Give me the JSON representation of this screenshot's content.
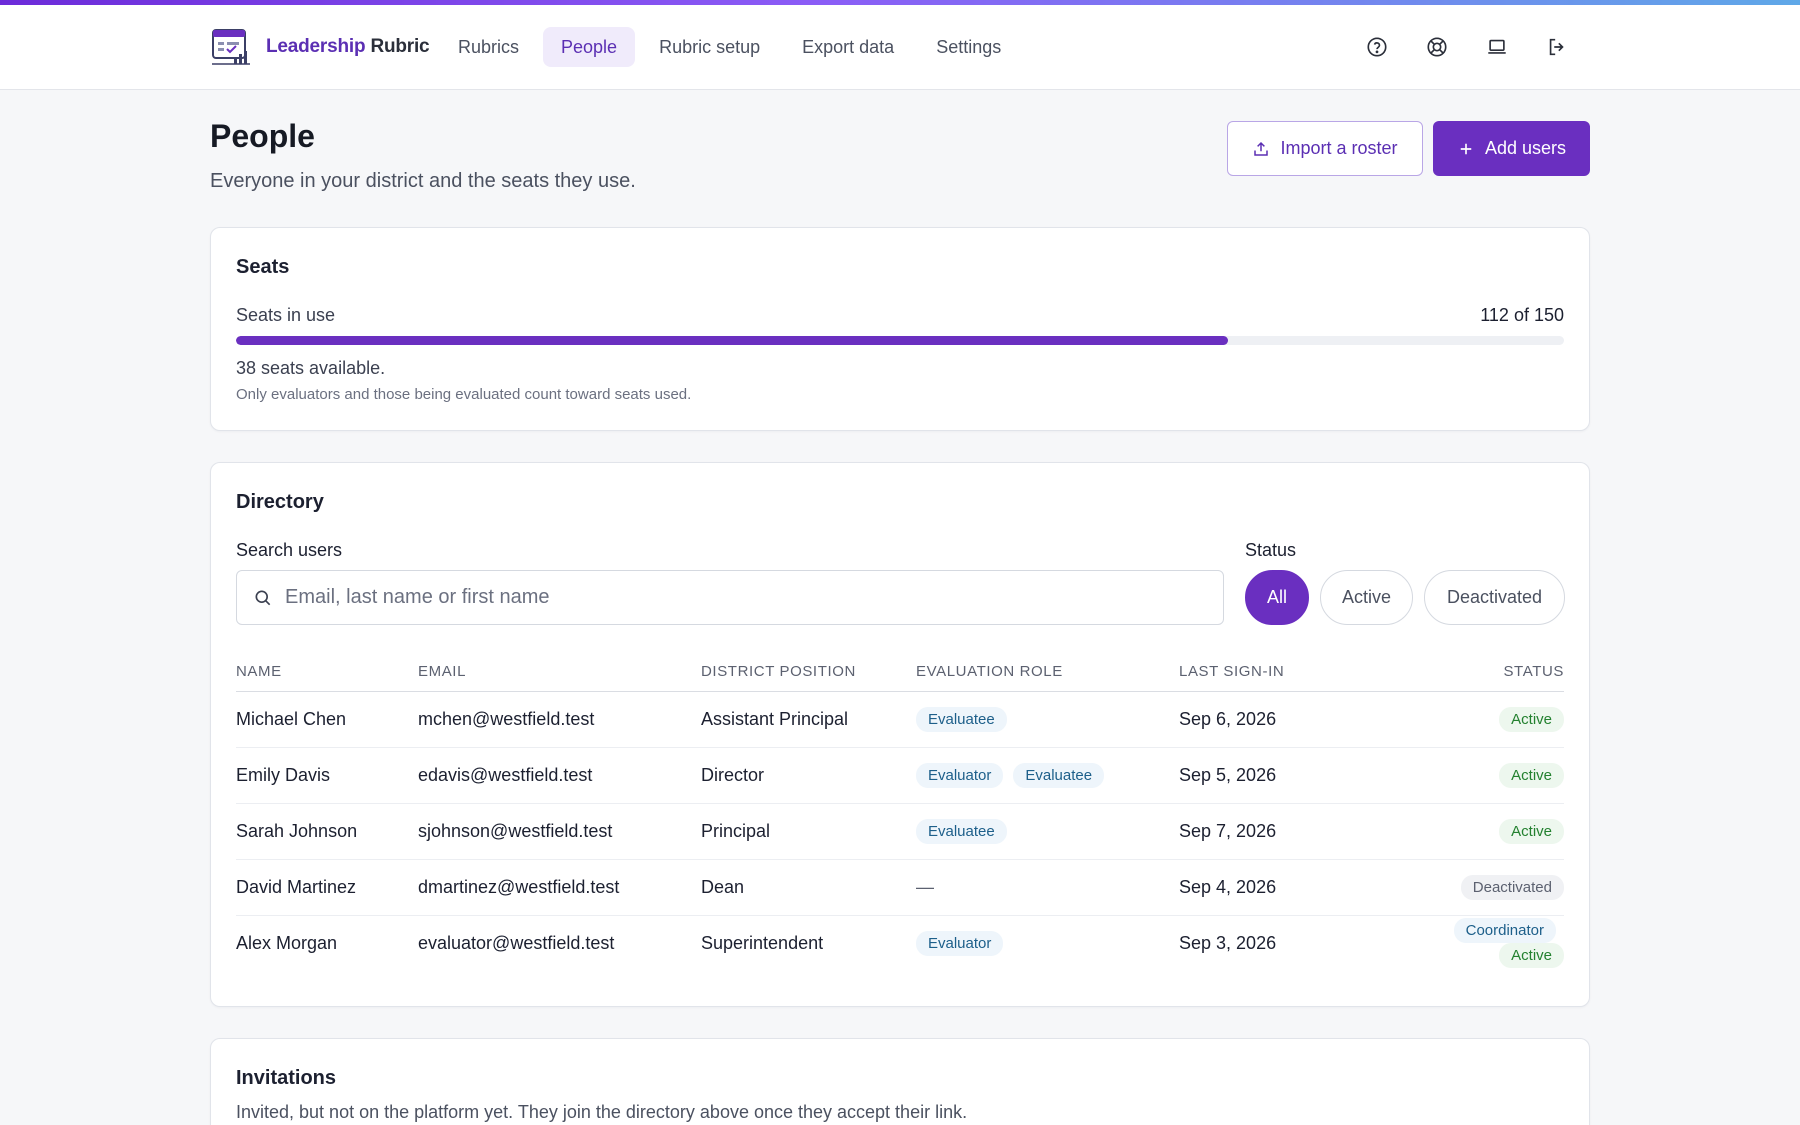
{
  "brand": {
    "name_accent": "Leadership",
    "name_rest": " Rubric"
  },
  "nav": {
    "links": [
      {
        "label": "Rubrics",
        "active": false
      },
      {
        "label": "People",
        "active": true
      },
      {
        "label": "Rubric setup",
        "active": false
      },
      {
        "label": "Export data",
        "active": false
      },
      {
        "label": "Settings",
        "active": false
      }
    ],
    "icons": [
      "help-icon",
      "support-icon",
      "laptop-icon",
      "logout-icon"
    ]
  },
  "header": {
    "title": "People",
    "subtitle": "Everyone in your district and the seats they use.",
    "import_label": "Import a roster",
    "add_label": "Add users"
  },
  "seats": {
    "title": "Seats",
    "label": "Seats in use",
    "count_text": "112 of 150",
    "used": 112,
    "total": 150,
    "available_text": "38 seats available.",
    "note": "Only evaluators and those being evaluated count toward seats used."
  },
  "directory": {
    "title": "Directory",
    "search_label": "Search users",
    "search_placeholder": "Email, last name or first name",
    "search_value": "",
    "status_label": "Status",
    "filters": [
      {
        "label": "All",
        "selected": true
      },
      {
        "label": "Active",
        "selected": false
      },
      {
        "label": "Deactivated",
        "selected": false
      }
    ],
    "columns": [
      "NAME",
      "EMAIL",
      "DISTRICT POSITION",
      "EVALUATION ROLE",
      "LAST SIGN-IN",
      "STATUS"
    ],
    "rows": [
      {
        "name": "Michael Chen",
        "email": "mchen@westfield.test",
        "position": "Assistant Principal",
        "roles": [
          "Evaluatee"
        ],
        "last_signin": "Sep 6, 2026",
        "extra_badge": "",
        "status": "Active"
      },
      {
        "name": "Emily Davis",
        "email": "edavis@westfield.test",
        "position": "Director",
        "roles": [
          "Evaluator",
          "Evaluatee"
        ],
        "last_signin": "Sep 5, 2026",
        "extra_badge": "",
        "status": "Active"
      },
      {
        "name": "Sarah Johnson",
        "email": "sjohnson@westfield.test",
        "position": "Principal",
        "roles": [
          "Evaluatee"
        ],
        "last_signin": "Sep 7, 2026",
        "extra_badge": "",
        "status": "Active"
      },
      {
        "name": "David Martinez",
        "email": "dmartinez@westfield.test",
        "position": "Dean",
        "roles": [],
        "no_role": "—",
        "last_signin": "Sep 4, 2026",
        "extra_badge": "",
        "status": "Deactivated"
      },
      {
        "name": "Alex Morgan",
        "email": "evaluator@westfield.test",
        "position": "Superintendent",
        "roles": [
          "Evaluator"
        ],
        "last_signin": "Sep 3, 2026",
        "extra_badge": "Coordinator",
        "status": "Active"
      }
    ]
  },
  "invitations": {
    "title": "Invitations",
    "subtitle": "Invited, but not on the platform yet. They join the directory above once they accept their link."
  },
  "colors": {
    "accent": "#6a2fc0",
    "active_green": "#23812f",
    "role_blue": "#1d5f8a"
  }
}
